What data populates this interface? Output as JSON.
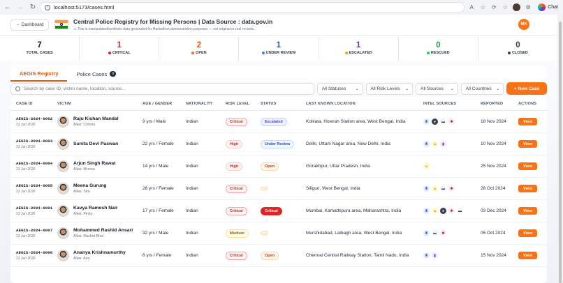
{
  "browser": {
    "url": "localhost:5173/cases.html",
    "chat_label": "Chat"
  },
  "header": {
    "back_label": "← Dashboard",
    "title": "Central Police Registry for Missing Persons | Data Source : data.gov.in",
    "disclaimer": "⚠ This is manipulated/synthetic data generated for Hackathon demonstration purposes — not original or real records.",
    "user_initials": "MK"
  },
  "stats": [
    {
      "value": "7",
      "label": "TOTAL CASES",
      "color": "#111827",
      "dot": ""
    },
    {
      "value": "1",
      "label": "CRITICAL",
      "color": "#dc2626",
      "dot": "#dc2626"
    },
    {
      "value": "2",
      "label": "OPEN",
      "color": "#ea580c",
      "dot": "#f97316"
    },
    {
      "value": "1",
      "label": "UNDER REVIEW",
      "color": "#1d4ed8",
      "dot": "#3b82f6"
    },
    {
      "value": "1",
      "label": "ESCALATED",
      "color": "#6d28d9",
      "dot": "#f59e0b"
    },
    {
      "value": "0",
      "label": "RESCUED",
      "color": "#16a34a",
      "dot": "#22c55e"
    },
    {
      "value": "0",
      "label": "CLOSED",
      "color": "#374151",
      "dot": "#374151"
    }
  ],
  "tabs": {
    "registry": "AEGIS Registry",
    "police": "Police Cases",
    "police_count": "0"
  },
  "toolbar": {
    "search_placeholder": "Search by case ID, victim name, location, source...",
    "status_filter": "All Statuses",
    "risk_filter": "All Risk Levels",
    "source_filter": "All Sources",
    "country_filter": "All Countries",
    "new_case_label": "+ New Case"
  },
  "table": {
    "headers": {
      "case_id": "CASE ID",
      "victim": "VICTIM",
      "age_gender": "AGE / GENDER",
      "nationality": "NATIONALITY",
      "risk": "RISK LEVEL",
      "status": "STATUS",
      "location": "LAST KNOWN LOCATION",
      "intel": "INTEL SOURCES",
      "reported": "REPORTED",
      "actions": "ACTIONS"
    },
    "view_label": "View",
    "rows": [
      {
        "id": "AEGIS-2024-0002",
        "date": "23 Jun 2026",
        "name": "Raju Kishan Mandal",
        "alias": "Alias: Chhotu",
        "age": "9 yrs / Male",
        "nationality": "Indian",
        "risk": "Critical",
        "status": "Escalated",
        "location": "Kolkata, Howrah Station area, West Bengal, India",
        "intel": [
          "police",
          "camera",
          "vehicle",
          "report"
        ],
        "reported": "18 Nov 2024"
      },
      {
        "id": "AEGIS-2024-0003",
        "date": "23 Jun 2026",
        "name": "Sunita Devi Paswan",
        "alias": "",
        "age": "22 yrs / Female",
        "nationality": "Indian",
        "risk": "High",
        "status": "Under Review",
        "location": "Delhi, Uttam Nagar area, New Delhi, India",
        "intel": [
          "police",
          "tip",
          "doc"
        ],
        "reported": "10 Nov 2024"
      },
      {
        "id": "AEGIS-2024-0004",
        "date": "23 Jun 2026",
        "name": "Arjun Singh Rawat",
        "alias": "Alias: Munna",
        "age": "14 yrs / Male",
        "nationality": "Indian",
        "risk": "High",
        "status": "Open",
        "location": "Gorakhpur, Uttar Pradesh, India",
        "intel": [
          "tip"
        ],
        "reported": "25 Nov 2024"
      },
      {
        "id": "AEGIS-2024-0005",
        "date": "23 Jun 2026",
        "name": "Meena Gurung",
        "alias": "Alias: Sita",
        "age": "28 yrs / Female",
        "nationality": "Indian",
        "risk": "Critical",
        "status": "",
        "location": "Siliguri, West Bengal, India",
        "intel": [
          "police",
          "tip",
          "vehicle",
          "report"
        ],
        "reported": "28 Oct 2024"
      },
      {
        "id": "AEGIS-2024-0001",
        "date": "23 Jun 2026",
        "name": "Kavya Ramesh Nair",
        "alias": "Alias: Pinky",
        "age": "17 yrs / Female",
        "nationality": "Indian",
        "risk": "Critical",
        "status": "Critical",
        "location": "Mumbai, Kamathipura area, Maharashtra, India",
        "intel": [
          "police",
          "tip",
          "camera",
          "report",
          "vehicle"
        ],
        "reported": "03 Dec 2024"
      },
      {
        "id": "AEGIS-2024-0007",
        "date": "23 Jun 2026",
        "name": "Mohammed Rashid Ansari",
        "alias": "Alias: Rashid Bhai",
        "age": "32 yrs / Male",
        "nationality": "Indian",
        "risk": "Medium",
        "status": "",
        "location": "Murshidabad, Lalbagh area, West Bengal, India",
        "intel": [
          "police",
          "vehicle",
          "report"
        ],
        "reported": "05 Oct 2024"
      },
      {
        "id": "AEGIS-2024-0006",
        "date": "23 Jun 2026",
        "name": "Ananya Krishnamurthy",
        "alias": "Alias: Anu",
        "age": "8 yrs / Female",
        "nationality": "Indian",
        "risk": "Critical",
        "status": "Open",
        "location": "Chennai Central Railway Station, Tamil Nadu, India",
        "intel": [
          "police",
          "doc"
        ],
        "reported": "15 Nov 2024"
      }
    ]
  },
  "colors": {
    "accent": "#f97316",
    "critical": "#dc2626"
  }
}
